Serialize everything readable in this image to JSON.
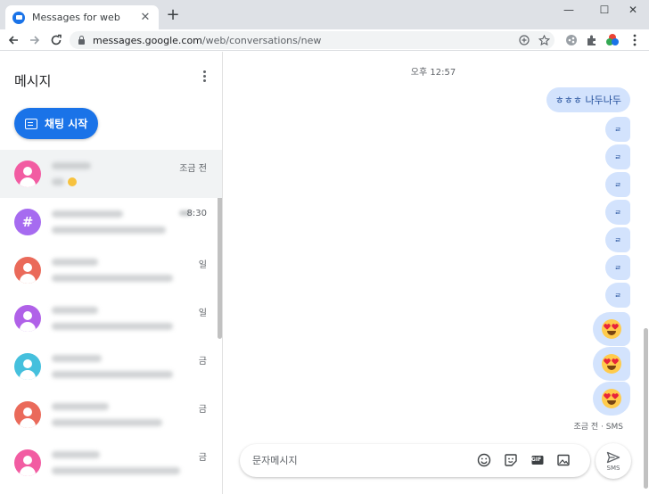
{
  "browser": {
    "tab_title": "Messages for web",
    "tab_close": "✕",
    "new_tab": "+",
    "window_controls": {
      "minimize": "—",
      "maximize": "☐",
      "close": "✕"
    },
    "url_host": "messages.google.com",
    "url_path": "/web/conversations/new"
  },
  "sidebar": {
    "title": "메시지",
    "start_chat_label": "채팅 시작",
    "conversations": [
      {
        "avatar_color": "#f25ca2",
        "avatar": "person",
        "time": "조금 전",
        "active": true
      },
      {
        "avatar_color": "#a66bf0",
        "avatar": "#",
        "time": "8:30"
      },
      {
        "avatar_color": "#ea6a5a",
        "avatar": "person",
        "time": "일"
      },
      {
        "avatar_color": "#b061e8",
        "avatar": "person",
        "time": "일"
      },
      {
        "avatar_color": "#45c0dd",
        "avatar": "person",
        "time": "금"
      },
      {
        "avatar_color": "#ea6a5a",
        "avatar": "person",
        "time": "금"
      },
      {
        "avatar_color": "#f25ca2",
        "avatar": "person",
        "time": "금"
      }
    ]
  },
  "conversation": {
    "timestamp": "오후 12:57",
    "messages": [
      {
        "type": "text",
        "text": "ㅎㅎㅎ 나두나두"
      },
      {
        "type": "text",
        "text": "ㄹ"
      },
      {
        "type": "text",
        "text": "ㄹ"
      },
      {
        "type": "text",
        "text": "ㄹ"
      },
      {
        "type": "text",
        "text": "ㄹ"
      },
      {
        "type": "text",
        "text": "ㄹ"
      },
      {
        "type": "text",
        "text": "ㄹ"
      },
      {
        "type": "text",
        "text": "ㄹ"
      },
      {
        "type": "emoji",
        "icon": "heart-eyes-emoji"
      },
      {
        "type": "emoji",
        "icon": "heart-eyes-emoji"
      },
      {
        "type": "emoji",
        "icon": "heart-eyes-emoji"
      }
    ],
    "status": "조금 전 · SMS"
  },
  "composer": {
    "placeholder": "문자메시지",
    "gif_label": "GIF",
    "send_label": "SMS"
  },
  "colors": {
    "accent": "#1a73e8",
    "bubble": "#d3e3fd"
  }
}
